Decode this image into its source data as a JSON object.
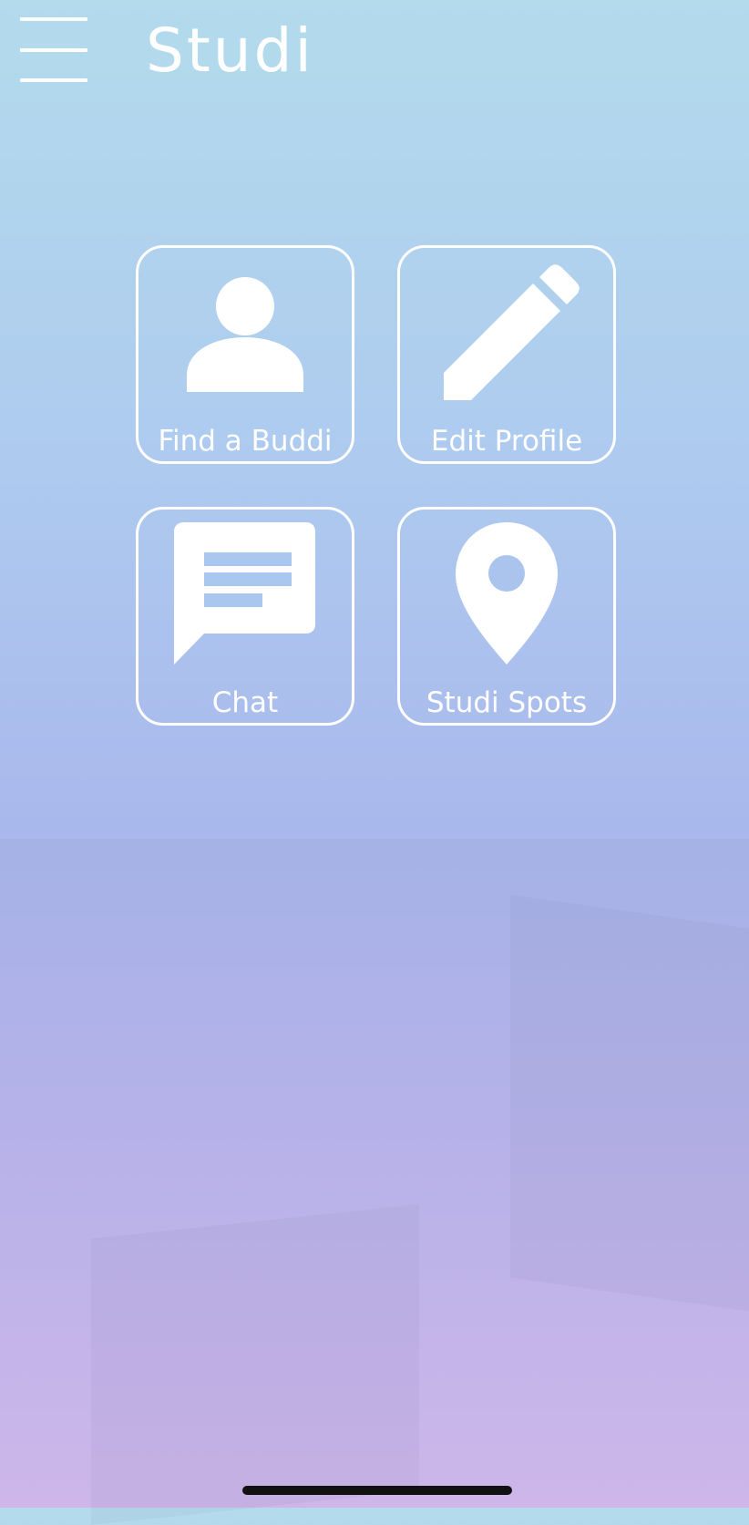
{
  "app": {
    "title": "Studi"
  },
  "header": {
    "menu_icon": "hamburger-menu-icon"
  },
  "tiles": [
    {
      "label": "Find a Buddi",
      "icon": "person-icon"
    },
    {
      "label": "Edit Profile",
      "icon": "pencil-icon"
    },
    {
      "label": "Chat",
      "icon": "chat-bubble-icon"
    },
    {
      "label": "Studi Spots",
      "icon": "location-pin-icon"
    }
  ],
  "colors": {
    "foreground": "#ffffff",
    "gradient_top": "#b3dbec",
    "gradient_bottom": "#d6bcef",
    "home_indicator": "#111111"
  }
}
